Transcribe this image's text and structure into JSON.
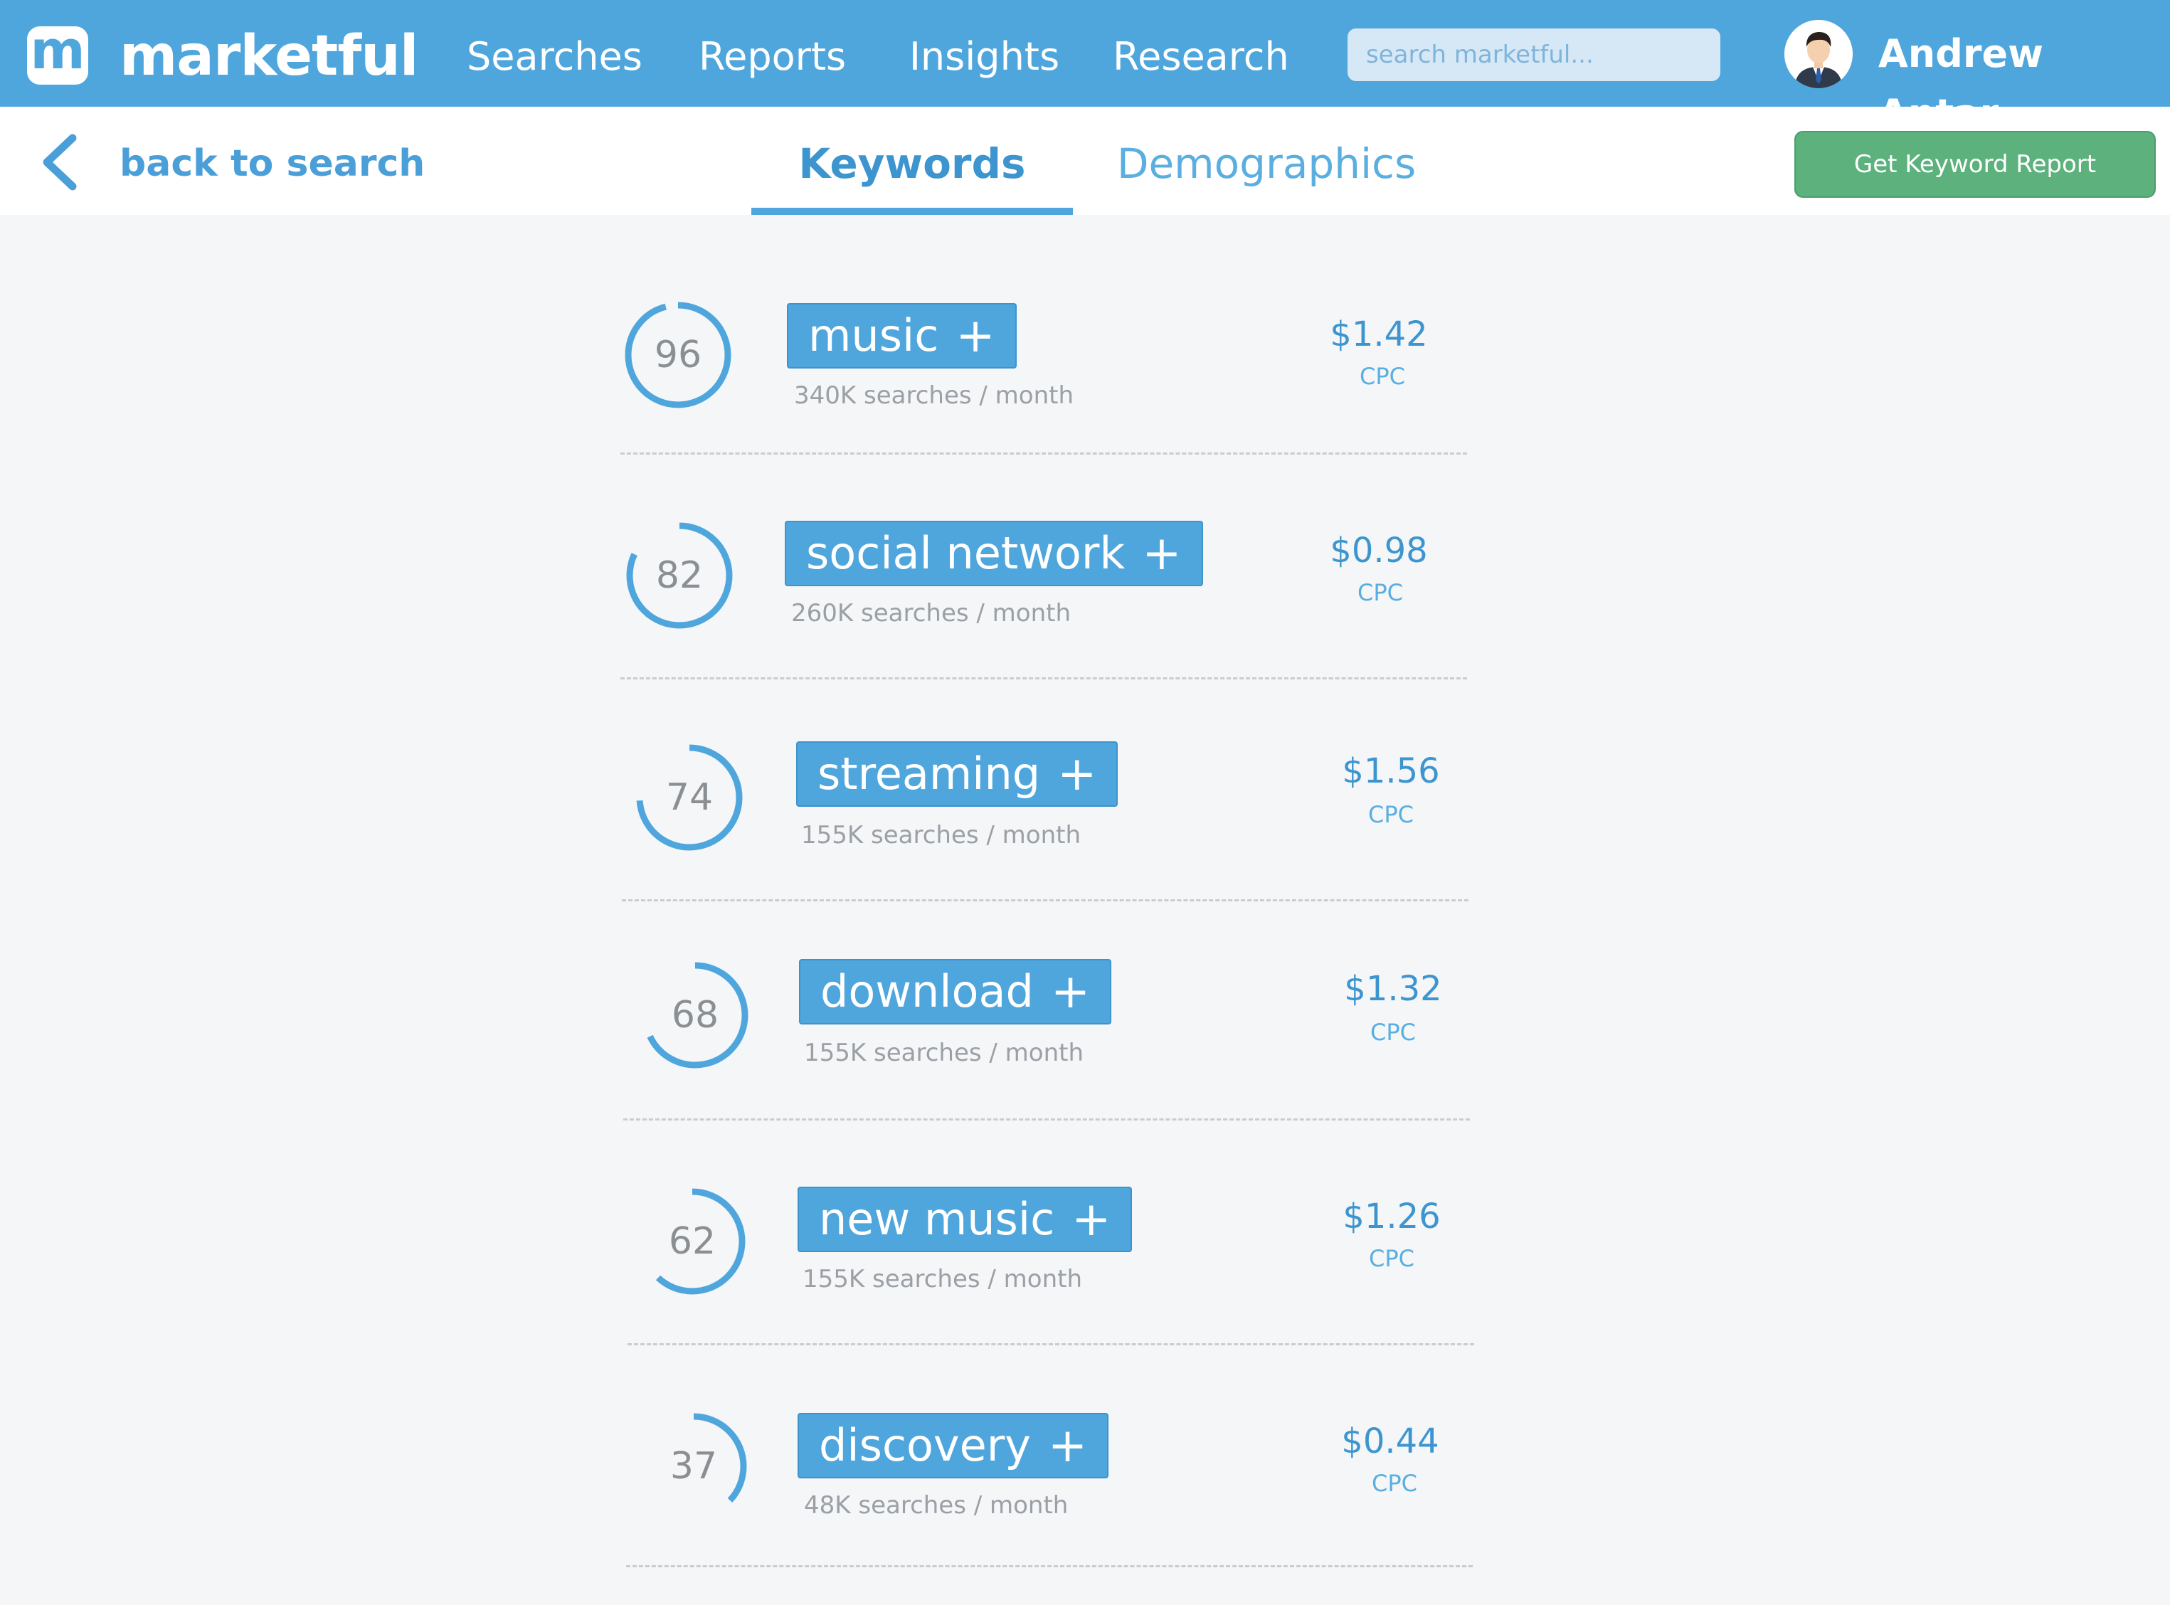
{
  "header": {
    "logo_letter": "m",
    "brand": "marketful",
    "nav": [
      "Searches",
      "Reports",
      "Insights",
      "Research"
    ],
    "search_placeholder": "search marketful...",
    "user_name": "Andrew Antar"
  },
  "subheader": {
    "back_label": "back to search",
    "tabs": [
      "Keywords",
      "Demographics"
    ],
    "active_tab": "Keywords",
    "report_button": "Get Keyword Report"
  },
  "keywords": [
    {
      "score": "96",
      "score_value": 96,
      "term": "music",
      "plus": "+",
      "volume": "340K searches / month",
      "cpc": "$1.42",
      "cpc_label": "CPC"
    },
    {
      "score": "82",
      "score_value": 82,
      "term": "social network",
      "plus": "+",
      "volume": "260K searches / month",
      "cpc": "$0.98",
      "cpc_label": "CPC"
    },
    {
      "score": "74",
      "score_value": 74,
      "term": "streaming",
      "plus": "+",
      "volume": "155K searches / month",
      "cpc": "$1.56",
      "cpc_label": "CPC"
    },
    {
      "score": "68",
      "score_value": 68,
      "term": "download",
      "plus": "+",
      "volume": "155K searches / month",
      "cpc": "$1.32",
      "cpc_label": "CPC"
    },
    {
      "score": "62",
      "score_value": 62,
      "term": "new music",
      "plus": "+",
      "volume": "155K searches / month",
      "cpc": "$1.26",
      "cpc_label": "CPC"
    },
    {
      "score": "37",
      "score_value": 37,
      "term": "discovery",
      "plus": "+",
      "volume": "48K searches / month",
      "cpc": "$0.44",
      "cpc_label": "CPC"
    }
  ],
  "colors": {
    "accent": "#4fa6dd",
    "report_button": "#5cb17c",
    "background": "#f4f6f8"
  }
}
